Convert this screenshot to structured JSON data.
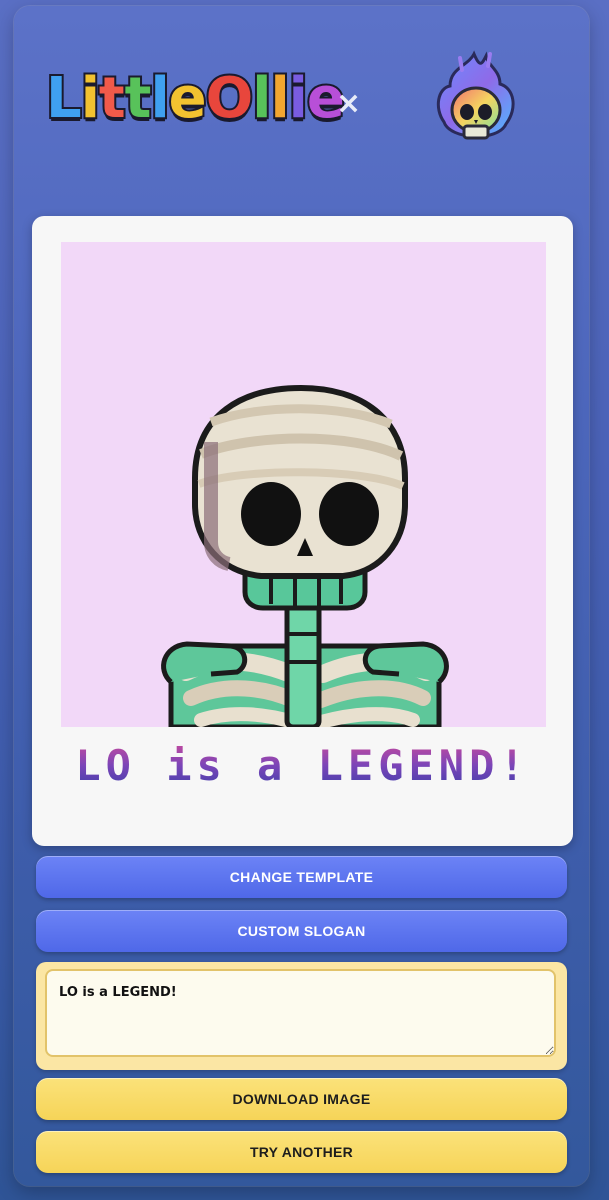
{
  "header": {
    "logo_letters": [
      "L",
      "i",
      "t",
      "t",
      "l",
      "e",
      "O",
      "l",
      "l",
      "i",
      "e"
    ],
    "logo_colors": [
      "#3fa0f0",
      "#f2c230",
      "#f15a4a",
      "#58c25a",
      "#3fa0f0",
      "#f2c230",
      "#e8463c",
      "#58c25a",
      "#f2a630",
      "#7a5ce0",
      "#b84fd8"
    ],
    "separator": "×",
    "skull_logo_icon": "flaming-skull-icon"
  },
  "preview": {
    "image_icon": "bandaged-skeleton-illustration",
    "background_color": "#f2d8f8",
    "slogan_text": "LO is a LEGEND!"
  },
  "buttons": {
    "change_template": "CHANGE TEMPLATE",
    "custom_slogan": "CUSTOM SLOGAN",
    "download_image": "DOWNLOAD IMAGE",
    "try_another": "TRY ANOTHER"
  },
  "slogan_input": {
    "value": "LO is a LEGEND!"
  },
  "colors": {
    "primary_blue": "#5a72ee",
    "accent_yellow": "#f8d95e"
  }
}
